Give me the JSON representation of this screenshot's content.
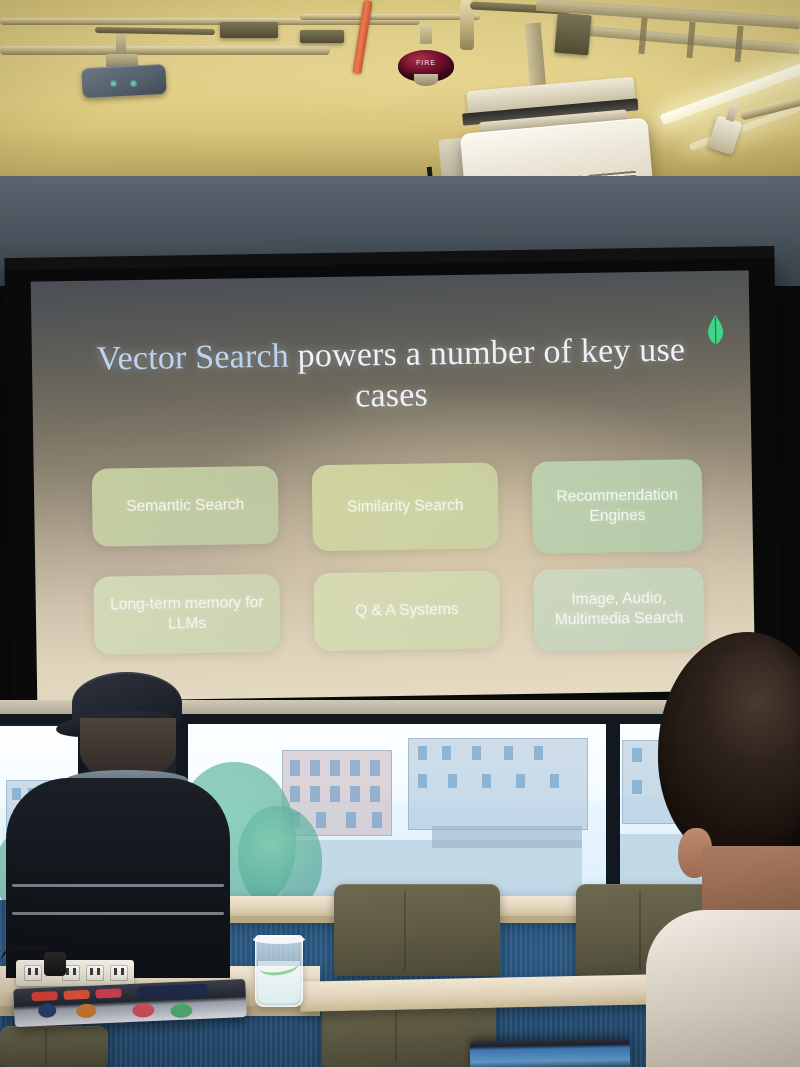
{
  "scene": {
    "setting_name": "conference-room-presentation",
    "room": {
      "ceiling_color": "#d9c87f",
      "upper_wall_color": "#4e5861",
      "floor_color": "#2d5b85"
    },
    "ceiling_equipment": [
      {
        "name": "ceiling-sensor",
        "label": ""
      },
      {
        "name": "projector",
        "label": ""
      },
      {
        "name": "fire-alarm-bell",
        "label": "FIRE"
      },
      {
        "name": "track-spotlight",
        "label": ""
      },
      {
        "name": "linear-light-strip",
        "label": ""
      },
      {
        "name": "recessed-downlight",
        "label": ""
      }
    ]
  },
  "slide": {
    "logo_name": "mongodb-leaf-logo",
    "logo_color": "#3fd98a",
    "title_highlight": "Vector Search",
    "title_rest": " powers a number of key use cases",
    "title_full": "Vector Search powers a number of key use cases",
    "title_highlight_color": "#bcd4ee",
    "title_color": "#eef2f6",
    "card_text_color": "#f4f8f2",
    "cards": [
      {
        "label": "Semantic Search",
        "color": "#cdd8a8"
      },
      {
        "label": "Similarity Search",
        "color": "#d6dca3"
      },
      {
        "label": "Recommendation Engines",
        "color": "#bed5b2"
      },
      {
        "label": "Long-term memory for LLMs",
        "color": "#d6dfba"
      },
      {
        "label": "Q & A Systems",
        "color": "#d8dfb4"
      },
      {
        "label": "Image, Audio, Multimedia Search",
        "color": "#cbdac0"
      }
    ]
  },
  "window": {
    "view_description": "city-view",
    "buildings": "brick-apartment-buildings",
    "foliage": "green-trees"
  },
  "foreground": {
    "person_left": {
      "name": "attendee-with-cap",
      "cap_color": "#20252e",
      "shirt_color": "#14181e"
    },
    "person_right": {
      "name": "attendee-foreground",
      "hair_color": "#2e231c",
      "shirt_color": "#ddd5c8"
    },
    "objects": [
      {
        "name": "laptop-with-stickers"
      },
      {
        "name": "power-outlet-strip"
      },
      {
        "name": "water-cup"
      },
      {
        "name": "conference-chair"
      },
      {
        "name": "conference-table"
      },
      {
        "name": "bottom-laptop-screen"
      }
    ]
  }
}
